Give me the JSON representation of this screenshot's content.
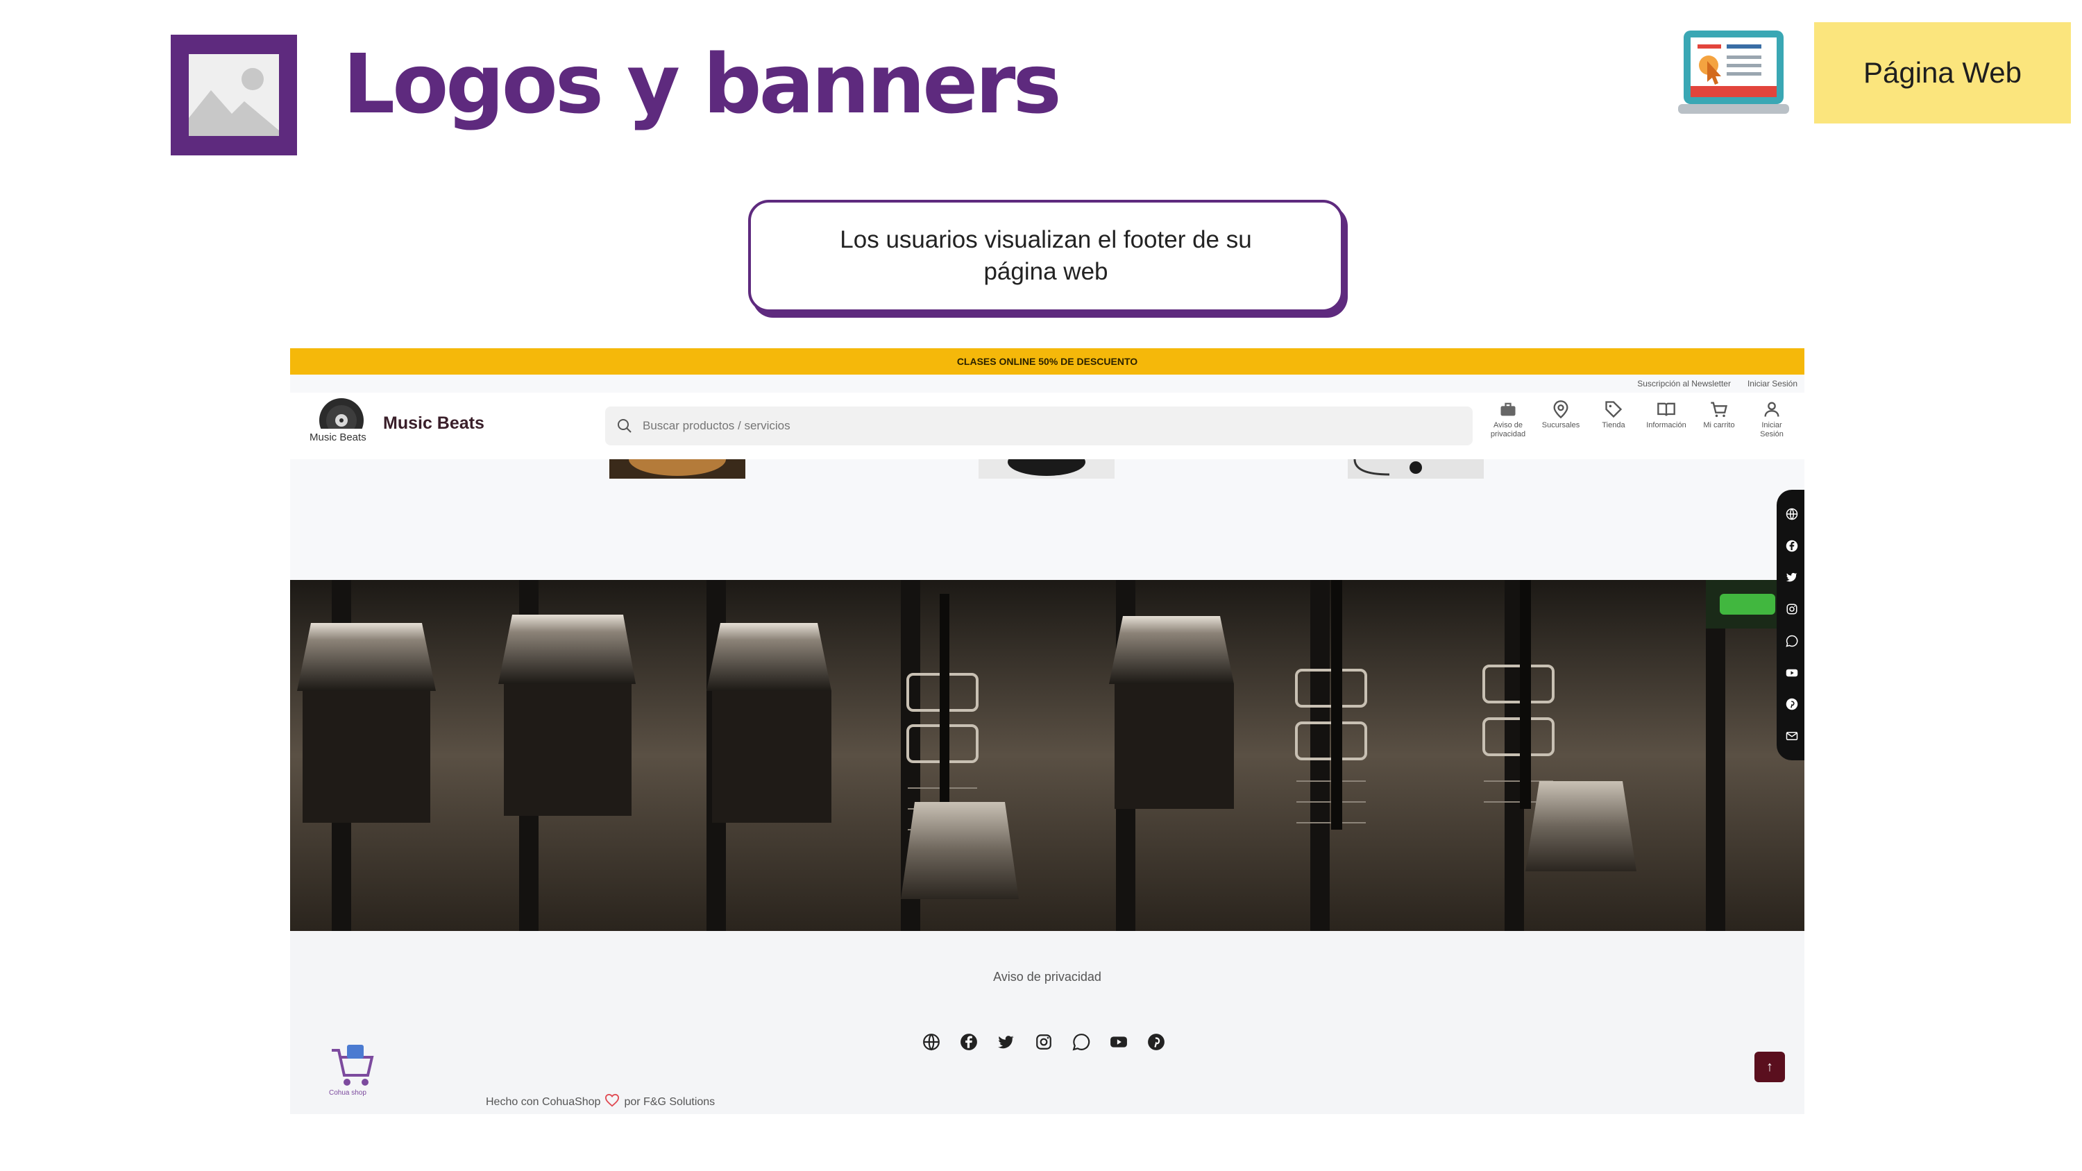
{
  "slide": {
    "title": "Logos y banners",
    "web_button": "Página Web",
    "callout": "Los usuarios visualizan el  footer de su página web"
  },
  "site": {
    "promo_text": "CLASES ONLINE 50% DE DESCUENTO",
    "toplinks": [
      "Suscripción al Newsletter",
      "Iniciar Sesión"
    ],
    "brand": "Music Beats",
    "logo_text": "Music Beats",
    "search_placeholder": "Buscar productos / servicios",
    "nav_items": [
      {
        "label": "Aviso de privacidad",
        "icon": "briefcase-icon"
      },
      {
        "label": "Sucursales",
        "icon": "location-pin-icon"
      },
      {
        "label": "Tienda",
        "icon": "tag-icon"
      },
      {
        "label": "Información",
        "icon": "book-icon"
      },
      {
        "label": "Mi carrito",
        "icon": "cart-icon"
      },
      {
        "label": "Iniciar Sesión",
        "icon": "user-icon"
      }
    ],
    "sidebar_icons": [
      "globe-icon",
      "facebook-icon",
      "twitter-icon",
      "instagram-icon",
      "whatsapp-icon",
      "youtube-icon",
      "pinterest-icon",
      "mail-icon"
    ],
    "footer": {
      "privacy_link": "Aviso de privacidad",
      "social_icons": [
        "globe-icon",
        "facebook-icon",
        "twitter-icon",
        "instagram-icon",
        "whatsapp-icon",
        "youtube-icon",
        "pinterest-icon"
      ],
      "cohua_label": "Cohua shop",
      "made_prefix": "Hecho con CohuaShop",
      "made_suffix": "por F&G Solutions",
      "top_button": "↑"
    }
  }
}
